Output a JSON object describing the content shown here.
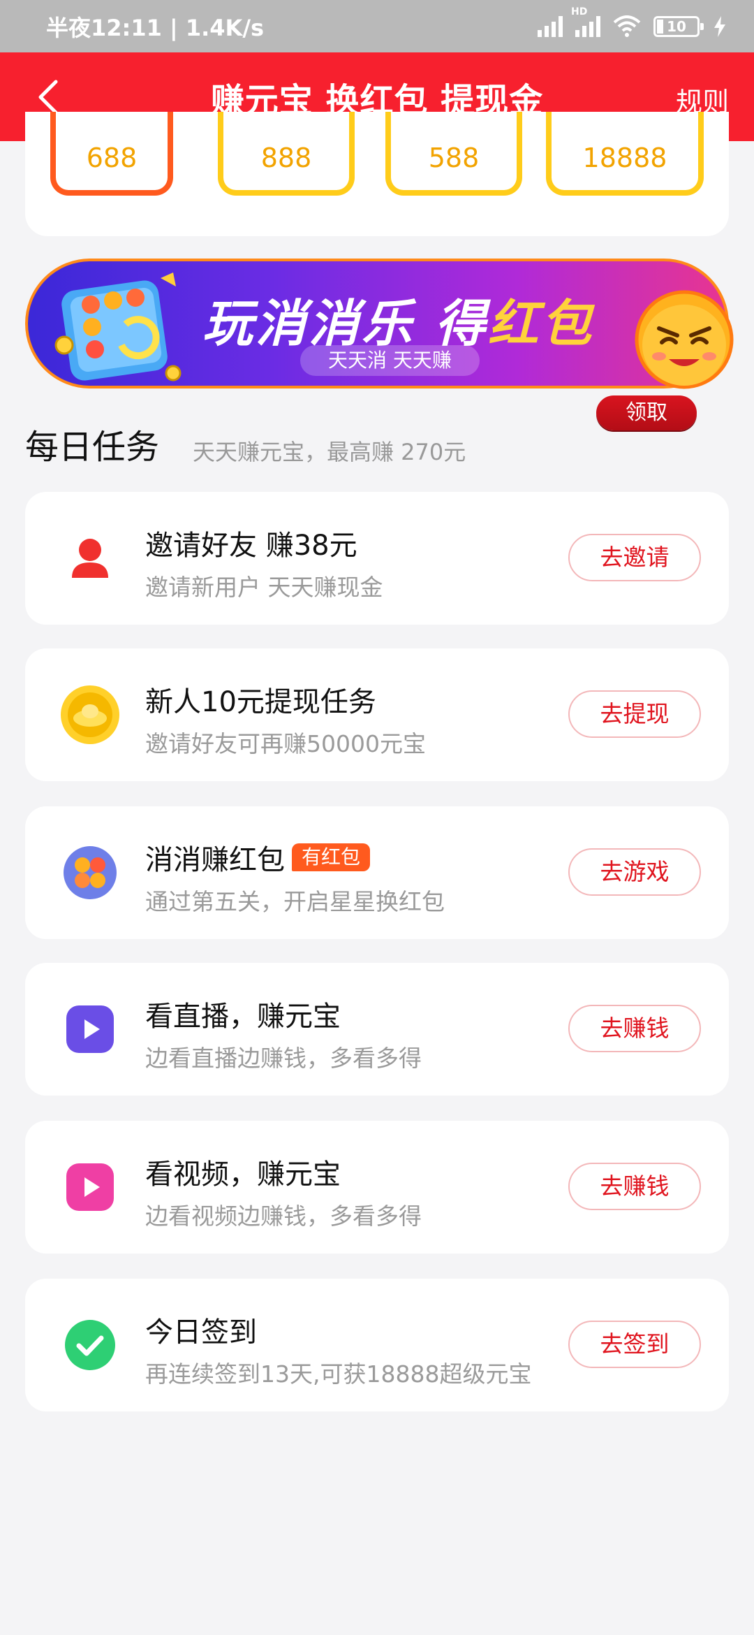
{
  "status_bar": {
    "time_speed": "半夜12:11 | 1.4K/s",
    "hd": "HD",
    "battery": "10"
  },
  "header": {
    "title": "赚元宝 换红包 提现金",
    "rules": "规则"
  },
  "reward_values": [
    "688",
    "888",
    "588",
    "18888"
  ],
  "banner": {
    "title_a": "玩消消乐 ",
    "title_b": "得",
    "title_c": "红包",
    "subtitle": "天天消 天天赚",
    "claim": "领取"
  },
  "section": {
    "title": "每日任务",
    "subtitle": "天天赚元宝，最高赚 270元"
  },
  "tasks": [
    {
      "icon": "person-icon",
      "title": "邀请好友 赚38元",
      "desc": "邀请新用户 天天赚现金",
      "button": "去邀请",
      "color": "#f0302e"
    },
    {
      "icon": "gold-ingot-icon",
      "title": "新人10元提现任务",
      "desc": "邀请好友可再赚50000元宝",
      "button": "去提现",
      "color": "#f7c21a"
    },
    {
      "icon": "game-icon",
      "title": "消消赚红包",
      "badge": "有红包",
      "desc": "通过第五关，开启星星换红包",
      "button": "去游戏",
      "color": "#6e7fe8"
    },
    {
      "icon": "live-play-icon",
      "title": "看直播，赚元宝",
      "desc": "边看直播边赚钱，多看多得",
      "button": "去赚钱",
      "color": "#6a4ee6"
    },
    {
      "icon": "video-play-icon",
      "title": "看视频，赚元宝",
      "desc": "边看视频边赚钱，多看多得",
      "button": "去赚钱",
      "color": "#ef3fa4"
    },
    {
      "icon": "check-icon",
      "title": "今日签到",
      "desc": "再连续签到13天,可获18888超级元宝",
      "button": "去签到",
      "color": "#2ecf74"
    }
  ]
}
